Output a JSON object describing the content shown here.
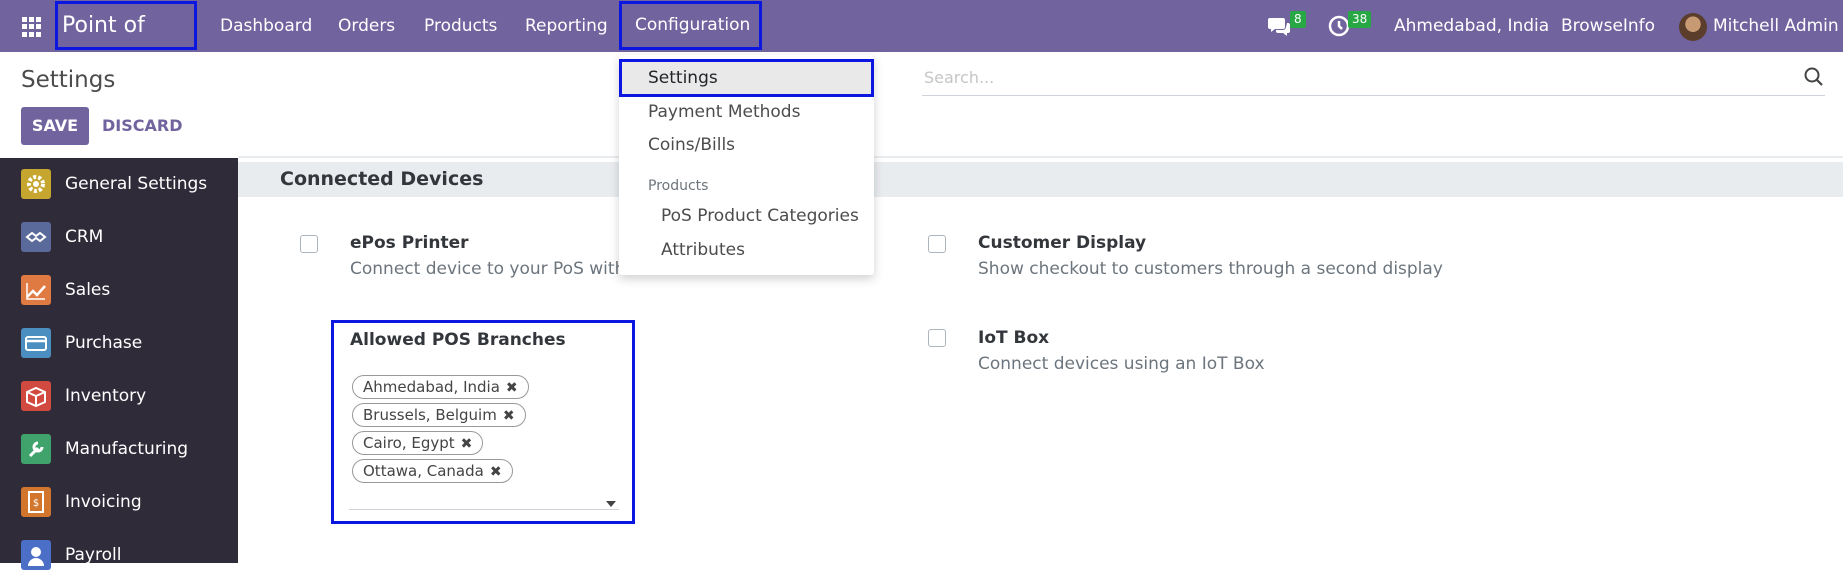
{
  "topbar": {
    "app_name": "Point of Sale",
    "nav": [
      "Dashboard",
      "Orders",
      "Products",
      "Reporting",
      "Configuration"
    ],
    "messages_count": "8",
    "activities_count": "38",
    "company": "Ahmedabad, India",
    "company2": "BrowseInfo",
    "user": "Mitchell Admin"
  },
  "control_panel": {
    "title": "Settings",
    "save_label": "SAVE",
    "discard_label": "DISCARD",
    "search_placeholder": "Search..."
  },
  "sidebar": {
    "items": [
      {
        "label": "General Settings",
        "icon": "gear-icon",
        "color": "#c6a62f"
      },
      {
        "label": "CRM",
        "icon": "handshake-icon",
        "color": "#5a6a9a"
      },
      {
        "label": "Sales",
        "icon": "chart-icon",
        "color": "#e07a43"
      },
      {
        "label": "Purchase",
        "icon": "card-icon",
        "color": "#4a8fc0"
      },
      {
        "label": "Inventory",
        "icon": "box-icon",
        "color": "#d1493f"
      },
      {
        "label": "Manufacturing",
        "icon": "wrench-icon",
        "color": "#3fa36b"
      },
      {
        "label": "Invoicing",
        "icon": "invoice-icon",
        "color": "#d2762e"
      },
      {
        "label": "Payroll",
        "icon": "payroll-icon",
        "color": "#4b6ec7"
      }
    ]
  },
  "section": {
    "title": "Connected Devices",
    "settings": [
      {
        "title": "ePos Printer",
        "desc": "Connect device to your PoS withou"
      },
      {
        "title": "Customer Display",
        "desc": "Show checkout to customers through a second display"
      },
      {
        "title": "Allowed POS Branches",
        "desc": ""
      },
      {
        "title": "IoT Box",
        "desc": "Connect devices using an IoT Box"
      }
    ],
    "branches": [
      "Ahmedabad, India",
      "Brussels, Belguim",
      "Cairo, Egypt",
      "Ottawa, Canada"
    ]
  },
  "dropdown": {
    "items": [
      "Settings",
      "Payment Methods",
      "Coins/Bills"
    ],
    "header": "Products",
    "sub_items": [
      "PoS Product Categories",
      "Attributes"
    ]
  },
  "colors": {
    "brand": "#71639e",
    "highlight": "#0b16e0"
  }
}
